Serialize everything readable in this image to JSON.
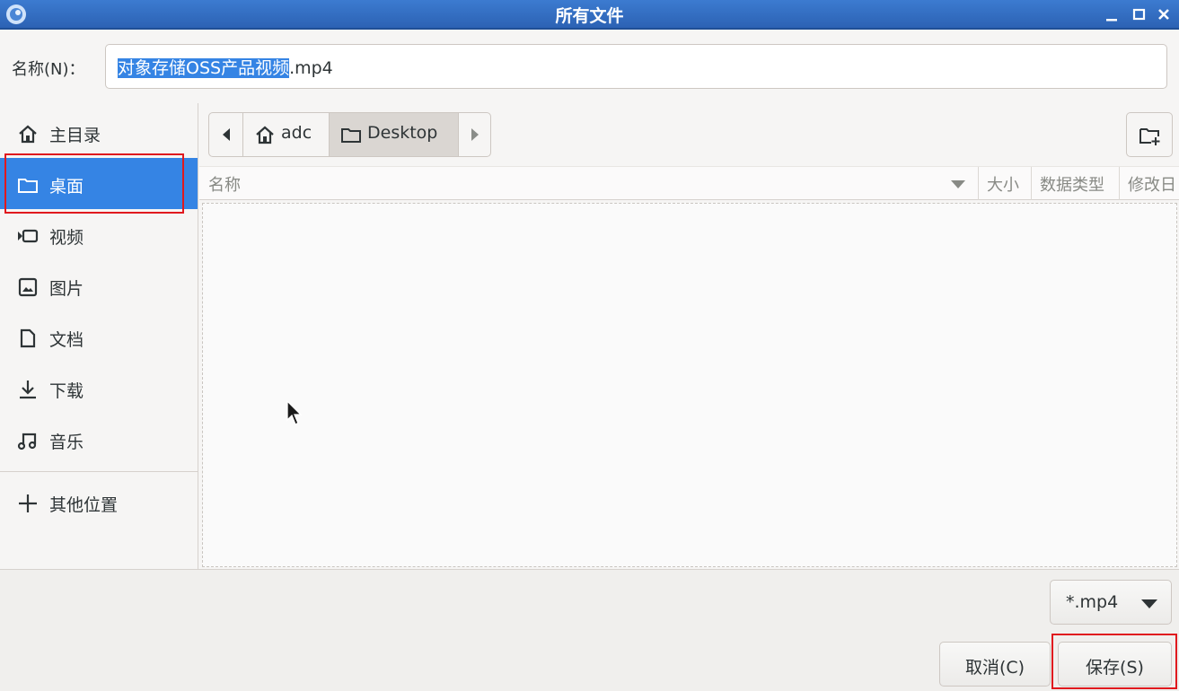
{
  "window": {
    "title": "所有文件",
    "buttons": {
      "minimize": "minimize-icon",
      "maximize": "maximize-icon",
      "close": "close-icon"
    }
  },
  "name_row": {
    "label": "名称(N)：",
    "value_selected": "对象存储OSS产品视频",
    "value_suffix": ".mp4"
  },
  "sidebar": {
    "items": [
      {
        "label": "主目录",
        "icon": "home-icon",
        "active": false
      },
      {
        "label": "桌面",
        "icon": "folder-icon",
        "active": true
      },
      {
        "label": "视频",
        "icon": "video-icon",
        "active": false
      },
      {
        "label": "图片",
        "icon": "image-icon",
        "active": false
      },
      {
        "label": "文档",
        "icon": "document-icon",
        "active": false
      },
      {
        "label": "下载",
        "icon": "download-icon",
        "active": false
      },
      {
        "label": "音乐",
        "icon": "music-icon",
        "active": false
      }
    ],
    "other_locations": {
      "label": "其他位置",
      "icon": "plus-icon"
    }
  },
  "pathbar": {
    "segments": [
      {
        "label": "adc",
        "icon": "home-icon"
      },
      {
        "label": "Desktop",
        "icon": "folder-icon",
        "active": true
      }
    ]
  },
  "columns": {
    "name": "名称",
    "size": "大小",
    "type": "数据类型",
    "modified": "修改日"
  },
  "filter": {
    "value": "*.mp4"
  },
  "actions": {
    "cancel": "取消(C)",
    "save": "保存(S)"
  },
  "colors": {
    "titlebar": "#2c62b4",
    "selection": "#3584e4",
    "highlight_box": "#e0191e"
  }
}
